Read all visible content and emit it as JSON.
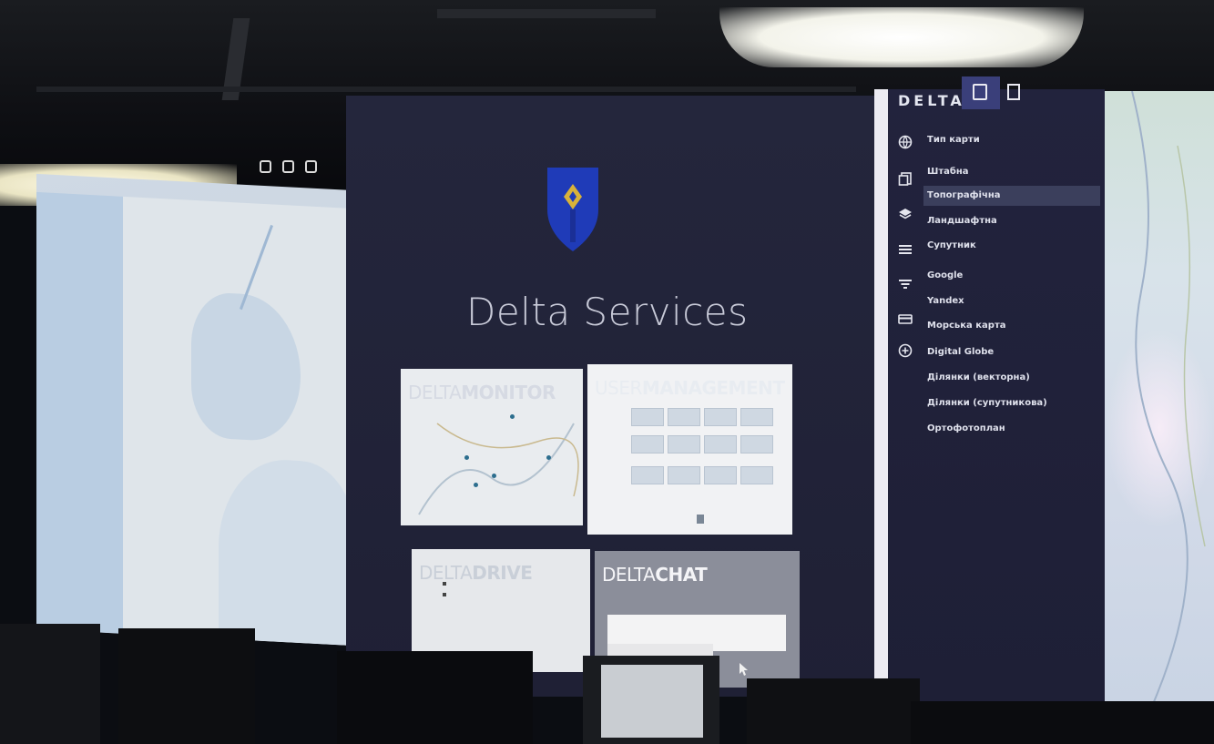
{
  "center": {
    "title": "Delta Services",
    "tiles": {
      "monitor": {
        "prefix": "DELTA",
        "suffix": "MONITOR"
      },
      "users": {
        "prefix": "USER",
        "suffix": "MANAGEMENT"
      },
      "drive": {
        "prefix": "DELTA",
        "suffix": "DRIVE"
      },
      "chat": {
        "prefix": "DELTA",
        "suffix": "CHAT"
      }
    }
  },
  "sidebar": {
    "brand": "DELTA",
    "header_label": "Тип карти",
    "items": [
      {
        "label": "Штабна"
      },
      {
        "label": "Топографічна",
        "active": true
      },
      {
        "label": "Ландшафтна"
      },
      {
        "label": "Супутник"
      },
      {
        "label": "Google"
      },
      {
        "label": "Yandex"
      },
      {
        "label": "Морська карта"
      },
      {
        "label": "Digital Globe"
      },
      {
        "label": "Ділянки (векторна)"
      },
      {
        "label": "Ділянки (супутникова)"
      },
      {
        "label": "Ортофотоплан"
      }
    ],
    "icons": [
      "globe-icon",
      "layers-card-icon",
      "layers-icon",
      "list-icon",
      "filter-icon",
      "card-icon",
      "add-circle-icon"
    ]
  },
  "colors": {
    "panel_bg": "#22233d",
    "active_tab": "#3a3f7a",
    "emblem_blue": "#1f3bb8",
    "emblem_gold": "#d8b23a"
  }
}
